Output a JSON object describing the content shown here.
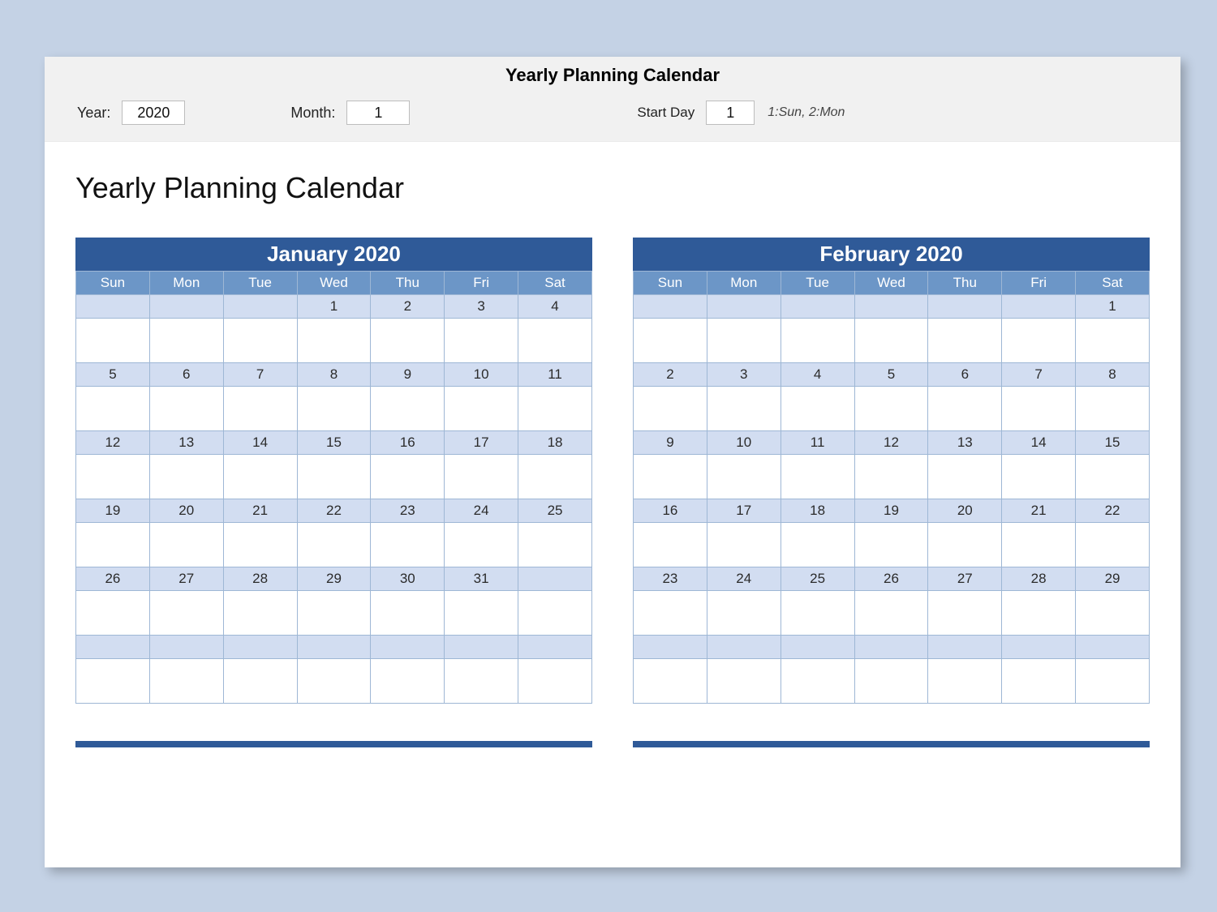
{
  "controls": {
    "title": "Yearly Planning Calendar",
    "year_label": "Year:",
    "year_value": "2020",
    "month_label": "Month:",
    "month_value": "1",
    "startday_label": "Start Day",
    "startday_value": "1",
    "startday_hint": "1:Sun, 2:Mon"
  },
  "heading": "Yearly Planning Calendar",
  "dow": [
    "Sun",
    "Mon",
    "Tue",
    "Wed",
    "Thu",
    "Fri",
    "Sat"
  ],
  "months": [
    {
      "title": "January 2020",
      "weeks": [
        [
          "",
          "",
          "",
          "1",
          "2",
          "3",
          "4"
        ],
        [
          "5",
          "6",
          "7",
          "8",
          "9",
          "10",
          "11"
        ],
        [
          "12",
          "13",
          "14",
          "15",
          "16",
          "17",
          "18"
        ],
        [
          "19",
          "20",
          "21",
          "22",
          "23",
          "24",
          "25"
        ],
        [
          "26",
          "27",
          "28",
          "29",
          "30",
          "31",
          ""
        ],
        [
          "",
          "",
          "",
          "",
          "",
          "",
          ""
        ]
      ]
    },
    {
      "title": "February 2020",
      "weeks": [
        [
          "",
          "",
          "",
          "",
          "",
          "",
          "1"
        ],
        [
          "2",
          "3",
          "4",
          "5",
          "6",
          "7",
          "8"
        ],
        [
          "9",
          "10",
          "11",
          "12",
          "13",
          "14",
          "15"
        ],
        [
          "16",
          "17",
          "18",
          "19",
          "20",
          "21",
          "22"
        ],
        [
          "23",
          "24",
          "25",
          "26",
          "27",
          "28",
          "29"
        ],
        [
          "",
          "",
          "",
          "",
          "",
          "",
          ""
        ]
      ]
    }
  ]
}
